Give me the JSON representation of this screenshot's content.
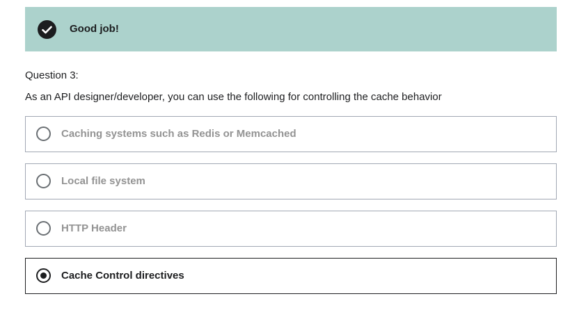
{
  "banner": {
    "icon": "check-circle-icon",
    "text": "Good job!",
    "color": "#acd2cc"
  },
  "question": {
    "number": "Question 3:",
    "text": "As an API designer/developer, you can use the following for controlling the cache behavior"
  },
  "options": [
    {
      "label": "Caching systems such as Redis or Memcached",
      "selected": false
    },
    {
      "label": "Local file system",
      "selected": false
    },
    {
      "label": "HTTP Header",
      "selected": false
    },
    {
      "label": "Cache Control directives",
      "selected": true
    }
  ]
}
